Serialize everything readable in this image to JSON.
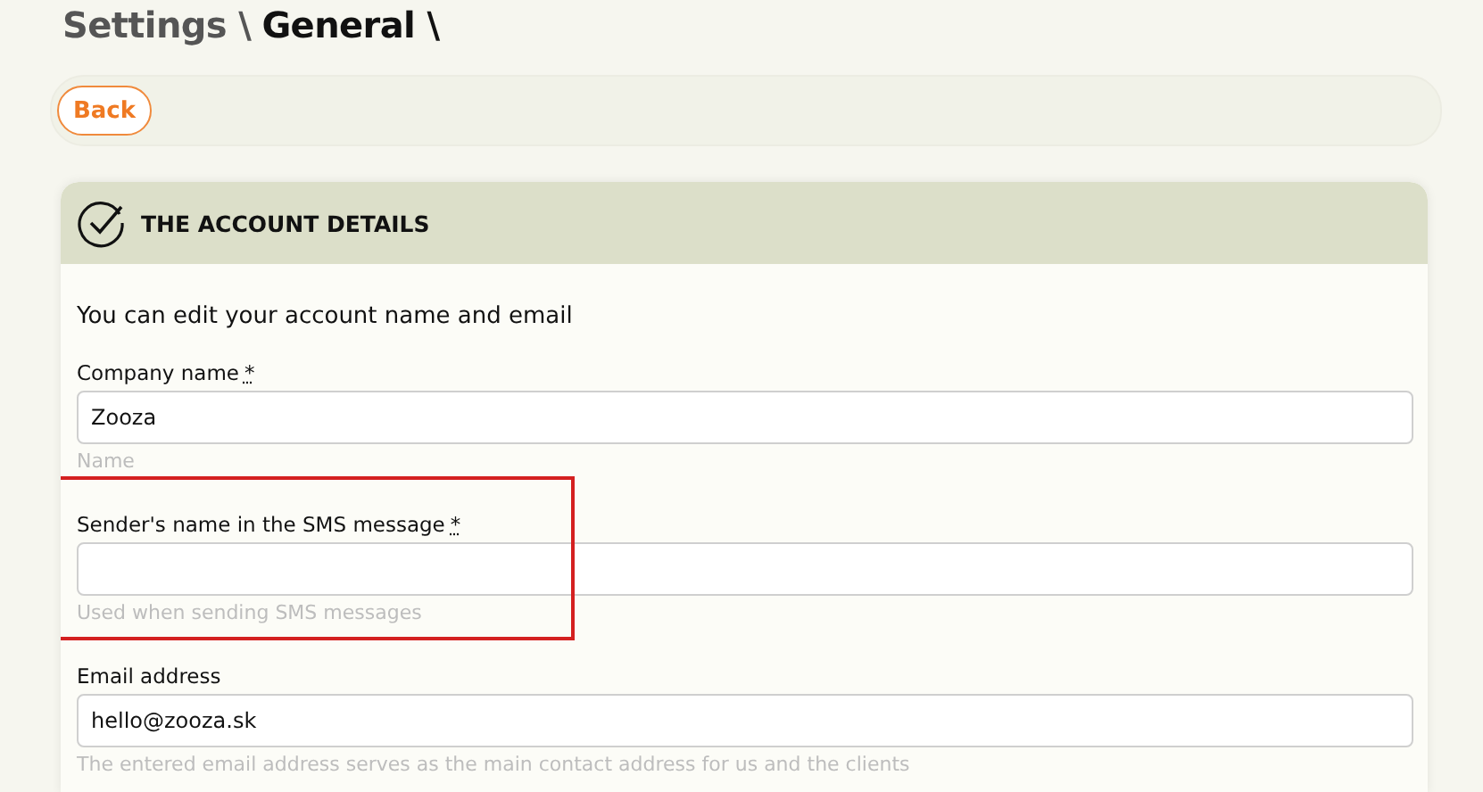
{
  "breadcrumbs": [
    {
      "label": "Settings \\",
      "current": false
    },
    {
      "label": "General \\",
      "current": true
    }
  ],
  "back_button": {
    "label": "Back"
  },
  "card": {
    "title": "THE ACCOUNT DETAILS",
    "intro": "You can edit your account name and email",
    "fields": [
      {
        "label": "Company name",
        "required_mark": "*",
        "value": "Zooza",
        "hint": "Name",
        "highlighted": false
      },
      {
        "label": "Sender's name in the SMS message",
        "required_mark": "*",
        "hint": "Used when sending SMS messages",
        "highlighted": true
      },
      {
        "label": "Email address",
        "value": "hello@zooza.sk",
        "hint": "The entered email address serves as the main contact address for us and the clients",
        "highlighted": false
      }
    ]
  }
}
